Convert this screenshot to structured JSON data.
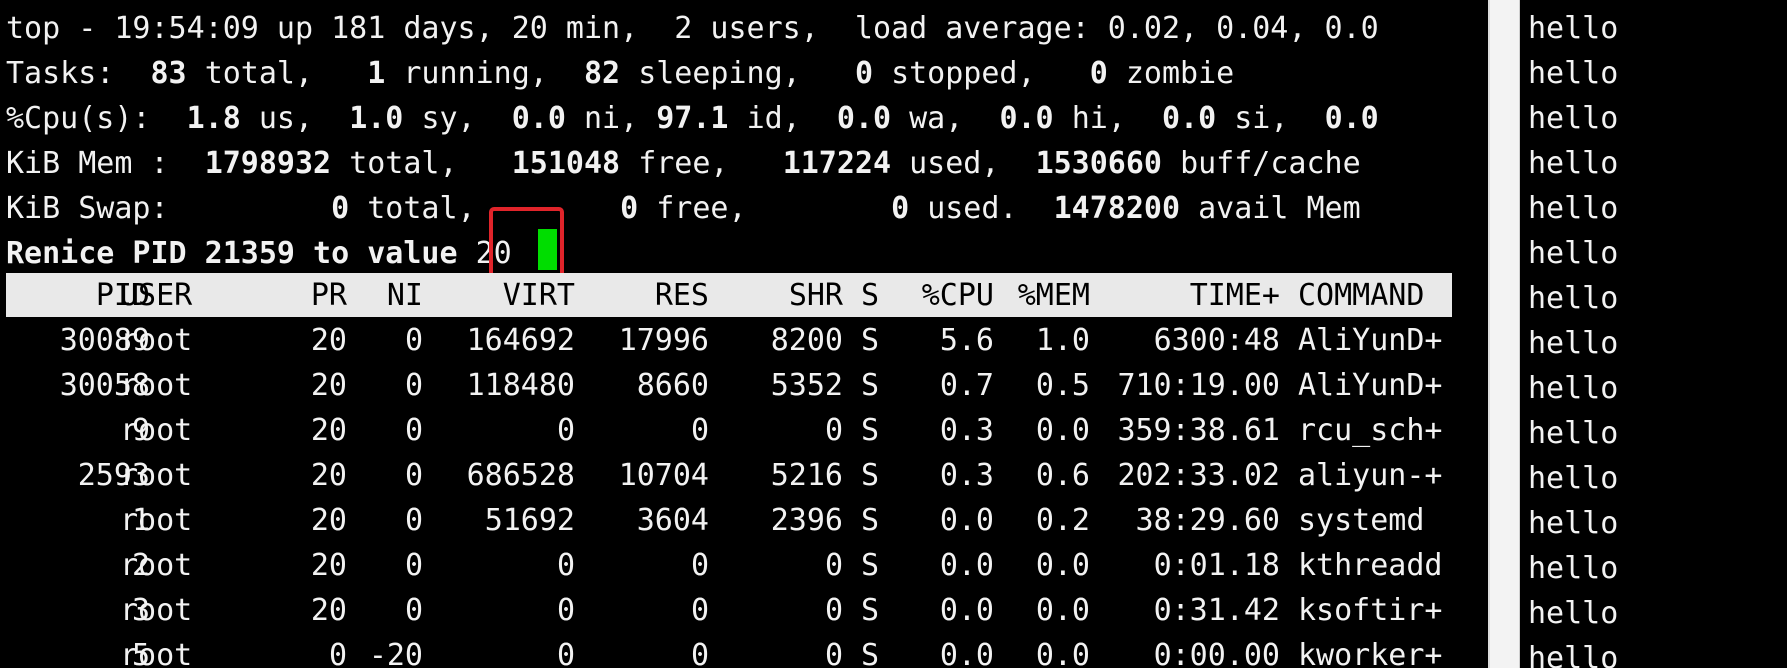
{
  "summary": {
    "line1": "top - 19:54:09 up 181 days, 20 min,  2 users,  load average: 0.02, 0.04, 0.0",
    "tasks": {
      "label": "Tasks:",
      "total": "83",
      "total_label": "total,",
      "running": "1",
      "running_label": "running,",
      "sleeping": "82",
      "sleeping_label": "sleeping,",
      "stopped": "0",
      "stopped_label": "stopped,",
      "zombie": "0",
      "zombie_label": "zombie"
    },
    "cpu": {
      "label": "%Cpu(s):",
      "us": "1.8",
      "us_label": "us,",
      "sy": "1.0",
      "sy_label": "sy,",
      "ni": "0.0",
      "ni_label": "ni,",
      "id": "97.1",
      "id_label": "id,",
      "wa": "0.0",
      "wa_label": "wa,",
      "hi": "0.0",
      "hi_label": "hi,",
      "si": "0.0",
      "si_label": "si,",
      "st": "0.0"
    },
    "mem": {
      "label": "KiB Mem :",
      "total": "1798932",
      "total_label": "total,",
      "free": "151048",
      "free_label": "free,",
      "used": "117224",
      "used_label": "used,",
      "cache": "1530660",
      "cache_label": "buff/cache"
    },
    "swap": {
      "label": "KiB Swap:",
      "total": "0",
      "total_label": "total,",
      "free": "0",
      "free_label": "free,",
      "used": "0",
      "used_label": "used.",
      "avail": "1478200",
      "avail_label": "avail Mem"
    }
  },
  "prompt": {
    "text": "Renice PID 21359 to value",
    "input_value": "20"
  },
  "table": {
    "headers": [
      "PID",
      "USER",
      "PR",
      "NI",
      "VIRT",
      "RES",
      "SHR",
      "S",
      "%CPU",
      "%MEM",
      "TIME+",
      "COMMAND"
    ],
    "rows": [
      [
        "30089",
        "root",
        "20",
        "0",
        "164692",
        "17996",
        "8200",
        "S",
        "5.6",
        "1.0",
        "6300:48",
        "AliYunD+"
      ],
      [
        "30058",
        "root",
        "20",
        "0",
        "118480",
        "8660",
        "5352",
        "S",
        "0.7",
        "0.5",
        "710:19.00",
        "AliYunD+"
      ],
      [
        "9",
        "root",
        "20",
        "0",
        "0",
        "0",
        "0",
        "S",
        "0.3",
        "0.0",
        "359:38.61",
        "rcu_sch+"
      ],
      [
        "2593",
        "root",
        "20",
        "0",
        "686528",
        "10704",
        "5216",
        "S",
        "0.3",
        "0.6",
        "202:33.02",
        "aliyun-+"
      ],
      [
        "1",
        "root",
        "20",
        "0",
        "51692",
        "3604",
        "2396",
        "S",
        "0.0",
        "0.2",
        "38:29.60",
        "systemd"
      ],
      [
        "2",
        "root",
        "20",
        "0",
        "0",
        "0",
        "0",
        "S",
        "0.0",
        "0.0",
        "0:01.18",
        "kthreadd"
      ],
      [
        "3",
        "root",
        "20",
        "0",
        "0",
        "0",
        "0",
        "S",
        "0.0",
        "0.0",
        "0:31.42",
        "ksoftir+"
      ],
      [
        "5",
        "root",
        "0",
        "-20",
        "0",
        "0",
        "0",
        "S",
        "0.0",
        "0.0",
        "0:00.00",
        "kworker+"
      ]
    ]
  },
  "right_pane": {
    "lines": [
      "hello",
      "hello",
      "hello",
      "hello",
      "hello",
      "hello",
      "hello",
      "hello",
      "hello",
      "hello",
      "hello",
      "hello",
      "hello",
      "hello",
      "hello"
    ]
  },
  "colors": {
    "background": "#000000",
    "foreground": "#f2f2f2",
    "cursor": "#00dd00",
    "highlight": "#e0242a",
    "header_bar": "#e9e9e9"
  }
}
